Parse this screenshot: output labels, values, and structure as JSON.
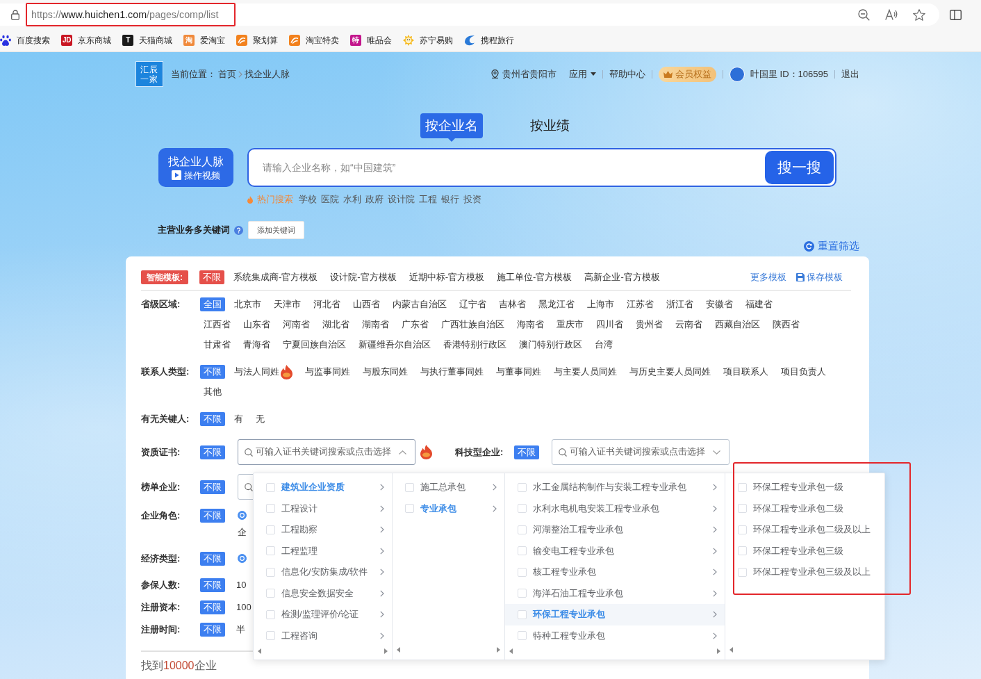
{
  "browser": {
    "url": {
      "scheme": "https://",
      "host": "www.huichen1.com",
      "path": "/pages/comp/list",
      "highlighted": true
    },
    "bookmarks": [
      {
        "label": "百度搜索",
        "kind": "paw",
        "color": "#2932e1"
      },
      {
        "label": "京东商城",
        "kind": "badge",
        "icon_text": "JD",
        "color": "#c91623"
      },
      {
        "label": "天猫商城",
        "kind": "badge",
        "icon_text": "T",
        "color": "#1a1a1a"
      },
      {
        "label": "爱淘宝",
        "kind": "badge",
        "icon_text": "淘",
        "color": "#f08a3c"
      },
      {
        "label": "聚划算",
        "kind": "swoosh",
        "color": "#f2811d"
      },
      {
        "label": "淘宝特卖",
        "kind": "swoosh",
        "color": "#f2811d"
      },
      {
        "label": "唯品会",
        "kind": "badge",
        "icon_text": "特",
        "color": "#c3168c"
      },
      {
        "label": "苏宁易购",
        "kind": "sun",
        "color": "#f6b81c"
      },
      {
        "label": "携程旅行",
        "kind": "swirl",
        "color": "#2a7ad8"
      }
    ]
  },
  "header": {
    "logo": [
      "汇辰",
      "一家"
    ],
    "breadcrumb": {
      "label": "当前位置：",
      "links": [
        "首页"
      ],
      "current": "找企业人脉"
    },
    "nav": {
      "location": "贵州省贵阳市",
      "apps": "应用",
      "help": "帮助中心",
      "member": "会员权益",
      "user": "叶国里 ID：106595",
      "logout": "退出"
    }
  },
  "search": {
    "tabs": [
      {
        "label": "按企业名",
        "selected": true
      },
      {
        "label": "按业绩",
        "selected": false
      }
    ],
    "guide": {
      "title": "找企业人脉",
      "subtitle": "操作视频"
    },
    "placeholder": "请输入企业名称，如“中国建筑”",
    "button": "搜一搜",
    "hot": {
      "label": "热门搜索",
      "items": [
        "学校",
        "医院",
        "水利",
        "政府",
        "设计院",
        "工程",
        "银行",
        "投资"
      ]
    },
    "keywords": {
      "label": "主营业务多关键词",
      "button": "添加关键词"
    },
    "reset": "重置筛选"
  },
  "filters": [
    {
      "kind": "template",
      "label": "智能模板:",
      "options": [
        {
          "label": "不限",
          "selected": true
        },
        {
          "label": "系统集成商-官方模板",
          "selected": false
        },
        {
          "label": "设计院-官方模板",
          "selected": false
        },
        {
          "label": "近期中标-官方模板",
          "selected": false
        },
        {
          "label": "施工单位-官方模板",
          "selected": false
        },
        {
          "label": "高新企业-官方模板",
          "selected": false
        }
      ],
      "actions": [
        {
          "label": "更多模板",
          "kind": "link"
        },
        {
          "label": "保存模板",
          "kind": "save"
        }
      ]
    },
    {
      "kind": "regions",
      "label": "省级区域:",
      "options": [
        {
          "label": "全国",
          "selected": true
        },
        {
          "label": "北京市",
          "selected": false
        },
        {
          "label": "天津市",
          "selected": false
        },
        {
          "label": "河北省",
          "selected": false
        },
        {
          "label": "山西省",
          "selected": false
        },
        {
          "label": "内蒙古自治区",
          "selected": false
        },
        {
          "label": "辽宁省",
          "selected": false
        },
        {
          "label": "吉林省",
          "selected": false
        },
        {
          "label": "黑龙江省",
          "selected": false
        },
        {
          "label": "上海市",
          "selected": false
        },
        {
          "label": "江苏省",
          "selected": false
        },
        {
          "label": "浙江省",
          "selected": false
        },
        {
          "label": "安徽省",
          "selected": false
        },
        {
          "label": "福建省",
          "selected": false
        },
        {
          "label": "江西省",
          "selected": false
        },
        {
          "label": "山东省",
          "selected": false
        },
        {
          "label": "河南省",
          "selected": false
        },
        {
          "label": "湖北省",
          "selected": false
        },
        {
          "label": "湖南省",
          "selected": false
        },
        {
          "label": "广东省",
          "selected": false
        },
        {
          "label": "广西壮族自治区",
          "selected": false
        },
        {
          "label": "海南省",
          "selected": false
        },
        {
          "label": "重庆市",
          "selected": false
        },
        {
          "label": "四川省",
          "selected": false
        },
        {
          "label": "贵州省",
          "selected": false
        },
        {
          "label": "云南省",
          "selected": false
        },
        {
          "label": "西藏自治区",
          "selected": false
        },
        {
          "label": "陕西省",
          "selected": false
        },
        {
          "label": "甘肃省",
          "selected": false
        },
        {
          "label": "青海省",
          "selected": false
        },
        {
          "label": "宁夏回族自治区",
          "selected": false
        },
        {
          "label": "新疆维吾尔自治区",
          "selected": false
        },
        {
          "label": "香港特别行政区",
          "selected": false
        },
        {
          "label": "澳门特别行政区",
          "selected": false
        },
        {
          "label": "台湾",
          "selected": false
        }
      ]
    },
    {
      "kind": "options",
      "label": "联系人类型:",
      "options": [
        {
          "label": "不限",
          "selected": true,
          "hot": false
        },
        {
          "label": "与法人同姓",
          "selected": false,
          "hot": true
        },
        {
          "label": "与监事同姓",
          "selected": false,
          "hot": false
        },
        {
          "label": "与股东同姓",
          "selected": false,
          "hot": false
        },
        {
          "label": "与执行董事同姓",
          "selected": false,
          "hot": false
        },
        {
          "label": "与董事同姓",
          "selected": false,
          "hot": false
        },
        {
          "label": "与主要人员同姓",
          "selected": false,
          "hot": false
        },
        {
          "label": "与历史主要人员同姓",
          "selected": false,
          "hot": false
        },
        {
          "label": "项目联系人",
          "selected": false,
          "hot": false
        },
        {
          "label": "项目负责人",
          "selected": false,
          "hot": false
        },
        {
          "label": "其他",
          "selected": false,
          "hot": false
        }
      ]
    },
    {
      "kind": "options",
      "label": "有无关键人:",
      "options": [
        {
          "label": "不限",
          "selected": true
        },
        {
          "label": "有",
          "selected": false
        },
        {
          "label": "无",
          "selected": false
        }
      ]
    },
    {
      "kind": "select",
      "label": "资质证书:",
      "options": [
        {
          "label": "不限",
          "selected": true
        }
      ],
      "hot": true,
      "select": {
        "placeholder": "可输入证书关键词搜索或点击选择",
        "open": true,
        "cascader": {
          "columns": [
            {
              "kind": "branch",
              "items": [
                {
                  "label": "建筑业企业资质",
                  "checked": false,
                  "selected": true,
                  "hovered": false
                },
                {
                  "label": "工程设计",
                  "checked": false,
                  "selected": false,
                  "hovered": false
                },
                {
                  "label": "工程勘察",
                  "checked": false,
                  "selected": false,
                  "hovered": false
                },
                {
                  "label": "工程监理",
                  "checked": false,
                  "selected": false,
                  "hovered": false
                },
                {
                  "label": "信息化/安防集成/软件",
                  "checked": false,
                  "selected": false,
                  "hovered": false
                },
                {
                  "label": "信息安全数据安全",
                  "checked": false,
                  "selected": false,
                  "hovered": false
                },
                {
                  "label": "检测/监理评价/论证",
                  "checked": false,
                  "selected": false,
                  "hovered": false
                },
                {
                  "label": "工程咨询",
                  "checked": false,
                  "selected": false,
                  "hovered": false
                }
              ]
            },
            {
              "kind": "branch",
              "items": [
                {
                  "label": "施工总承包",
                  "checked": false,
                  "selected": false,
                  "hovered": false
                },
                {
                  "label": "专业承包",
                  "checked": false,
                  "selected": true,
                  "hovered": false
                }
              ]
            },
            {
              "kind": "branch",
              "items": [
                {
                  "label": "水工金属结构制作与安装工程专业承包",
                  "checked": false,
                  "selected": false,
                  "hovered": false
                },
                {
                  "label": "水利水电机电安装工程专业承包",
                  "checked": false,
                  "selected": false,
                  "hovered": false
                },
                {
                  "label": "河湖整治工程专业承包",
                  "checked": false,
                  "selected": false,
                  "hovered": false
                },
                {
                  "label": "输变电工程专业承包",
                  "checked": false,
                  "selected": false,
                  "hovered": false
                },
                {
                  "label": "核工程专业承包",
                  "checked": false,
                  "selected": false,
                  "hovered": false
                },
                {
                  "label": "海洋石油工程专业承包",
                  "checked": false,
                  "selected": false,
                  "hovered": false
                },
                {
                  "label": "环保工程专业承包",
                  "checked": false,
                  "selected": true,
                  "hovered": true
                },
                {
                  "label": "特种工程专业承包",
                  "checked": false,
                  "selected": false,
                  "hovered": false
                }
              ]
            },
            {
              "kind": "leaf",
              "highlighted": true,
              "items": [
                {
                  "label": "环保工程专业承包一级",
                  "checked": false,
                  "selected": false,
                  "hovered": false
                },
                {
                  "label": "环保工程专业承包二级",
                  "checked": false,
                  "selected": false,
                  "hovered": false
                },
                {
                  "label": "环保工程专业承包二级及以上",
                  "checked": false,
                  "selected": false,
                  "hovered": false
                },
                {
                  "label": "环保工程专业承包三级",
                  "checked": false,
                  "selected": false,
                  "hovered": false
                },
                {
                  "label": "环保工程专业承包三级及以上",
                  "checked": false,
                  "selected": false,
                  "hovered": false
                }
              ]
            }
          ]
        }
      },
      "extra": {
        "label": "科技型企业:",
        "options": [
          {
            "label": "不限",
            "selected": true
          }
        ],
        "select": {
          "placeholder": "可输入证书关键词搜索或点击选择",
          "open": false
        }
      }
    },
    {
      "kind": "select",
      "label": "榜单企业:",
      "options": [
        {
          "label": "不限",
          "selected": true
        }
      ],
      "select": {
        "open": false
      }
    },
    {
      "kind": "radio",
      "label": "企业角色:",
      "options": [
        {
          "label": "不限",
          "selected": true
        }
      ],
      "radio": {
        "checked": true,
        "text": "企"
      }
    },
    {
      "kind": "radio",
      "label": "经济类型:",
      "options": [
        {
          "label": "不限",
          "selected": true
        }
      ],
      "radio": {
        "checked": true
      }
    },
    {
      "kind": "text",
      "label": "参保人数:",
      "options": [
        {
          "label": "不限",
          "selected": true
        }
      ],
      "text": "10"
    },
    {
      "kind": "text",
      "label": "注册资本:",
      "options": [
        {
          "label": "不限",
          "selected": true
        }
      ],
      "text": "100"
    },
    {
      "kind": "text",
      "label": "注册时间:",
      "options": [
        {
          "label": "不限",
          "selected": true
        }
      ],
      "text": "半"
    }
  ],
  "result": {
    "prefix": "找到",
    "count": "10000",
    "suffix": "企业"
  }
}
